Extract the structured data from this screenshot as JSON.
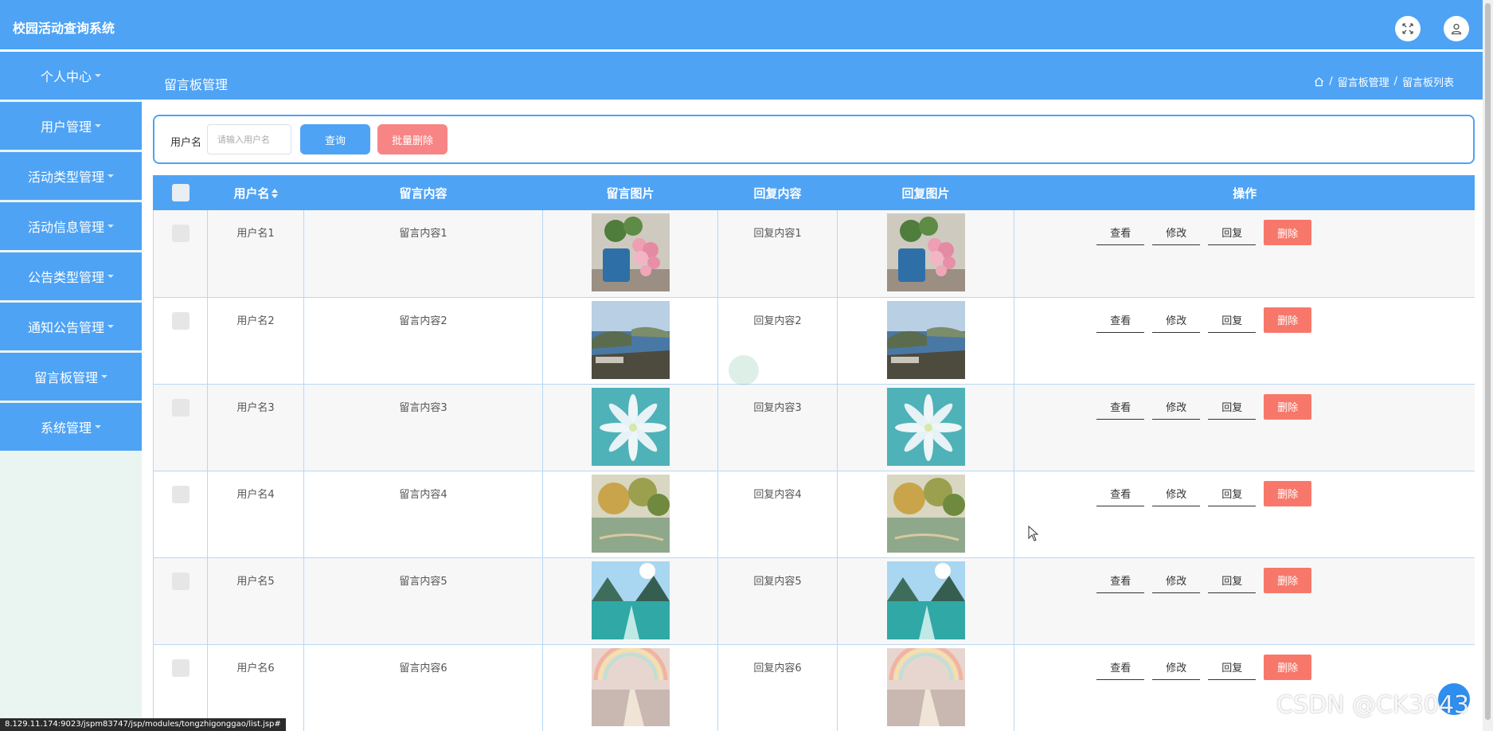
{
  "app": {
    "title": "校园活动查询系统"
  },
  "topbar": {
    "icons": [
      "fullscreen-icon",
      "user-icon"
    ]
  },
  "sidebar": {
    "items": [
      {
        "label": "个人中心"
      },
      {
        "label": "用户管理"
      },
      {
        "label": "活动类型管理"
      },
      {
        "label": "活动信息管理"
      },
      {
        "label": "公告类型管理"
      },
      {
        "label": "通知公告管理"
      },
      {
        "label": "留言板管理"
      },
      {
        "label": "系统管理"
      }
    ]
  },
  "page": {
    "title": "留言板管理",
    "breadcrumb": {
      "sep": "/",
      "parent": "留言板管理",
      "current": "留言板列表"
    }
  },
  "search": {
    "label": "用户名",
    "placeholder": "请输入用户名",
    "query_label": "查询",
    "batch_delete_label": "批量删除"
  },
  "table": {
    "columns": [
      "用户名",
      "留言内容",
      "留言图片",
      "回复内容",
      "回复图片",
      "操作"
    ],
    "rows": [
      {
        "username": "用户名1",
        "content": "留言内容1",
        "image": "flower-bouquet",
        "reply": "回复内容1",
        "reply_image": "flower-bouquet"
      },
      {
        "username": "用户名2",
        "content": "留言内容2",
        "image": "lake-landscape",
        "reply": "回复内容2",
        "reply_image": "lake-landscape"
      },
      {
        "username": "用户名3",
        "content": "留言内容3",
        "image": "white-flower",
        "reply": "回复内容3",
        "reply_image": "white-flower"
      },
      {
        "username": "用户名4",
        "content": "留言内容4",
        "image": "lakeside-trees",
        "reply": "回复内容4",
        "reply_image": "lakeside-trees"
      },
      {
        "username": "用户名5",
        "content": "留言内容5",
        "image": "mountain-river",
        "reply": "回复内容5",
        "reply_image": "mountain-river"
      },
      {
        "username": "用户名6",
        "content": "留言内容6",
        "image": "rainbow-path",
        "reply": "回复内容6",
        "reply_image": "rainbow-path"
      }
    ],
    "actions": {
      "view": "查看",
      "edit": "修改",
      "reply": "回复",
      "delete": "删除"
    }
  },
  "statusbar": {
    "url": "8.129.11.174:9023/jspm83747/jsp/modules/tongzhigonggao/list.jsp#"
  },
  "watermark": "CSDN @CK3043",
  "colors": {
    "primary": "#4ea3f5",
    "danger": "#f7786b",
    "sidebar_bg": "#eaf4f1"
  }
}
